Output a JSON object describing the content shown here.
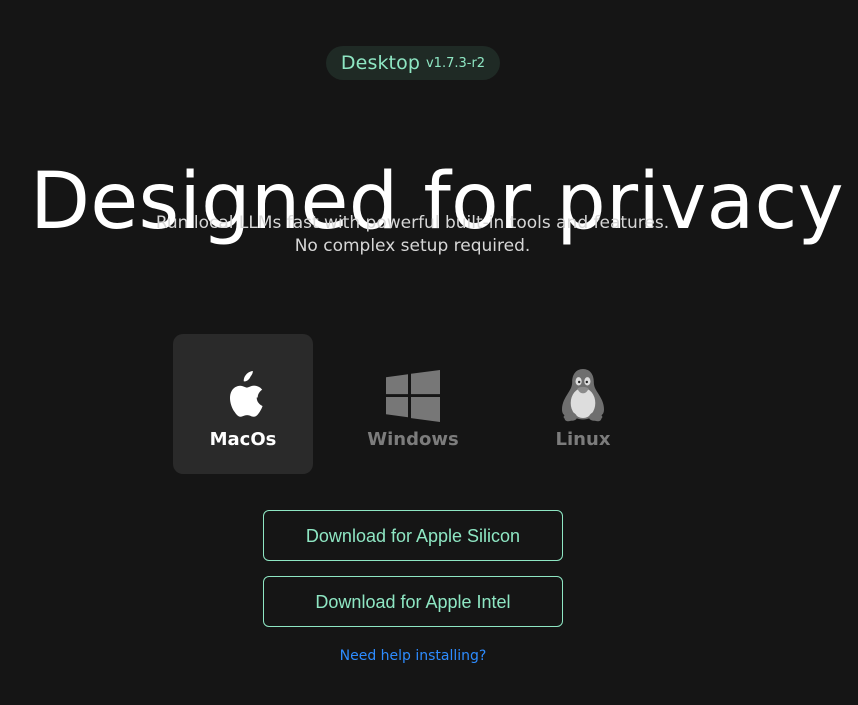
{
  "header": {
    "pill_label": "Desktop",
    "version": "v1.7.3-r2"
  },
  "hero": {
    "title": "Designed for privacy",
    "subtitle_line_1": "Run local LLMs fast with powerful built-in tools and features.",
    "subtitle_line_2": "No complex setup required."
  },
  "os_options": [
    {
      "label": "MacOs",
      "icon": "apple-icon",
      "selected": true
    },
    {
      "label": "Windows",
      "icon": "windows-icon",
      "selected": false
    },
    {
      "label": "Linux",
      "icon": "linux-penguin-icon",
      "selected": false
    }
  ],
  "downloads": {
    "apple_silicon": "Download for Apple Silicon",
    "apple_intel": "Download for Apple Intel"
  },
  "help": {
    "link_text": "Need help installing?"
  },
  "colors": {
    "background": "#151515",
    "accent": "#8ee6c3",
    "link": "#2d8cff",
    "selected_tile": "#2a2a2a",
    "inactive_text": "#7c7c7c"
  }
}
